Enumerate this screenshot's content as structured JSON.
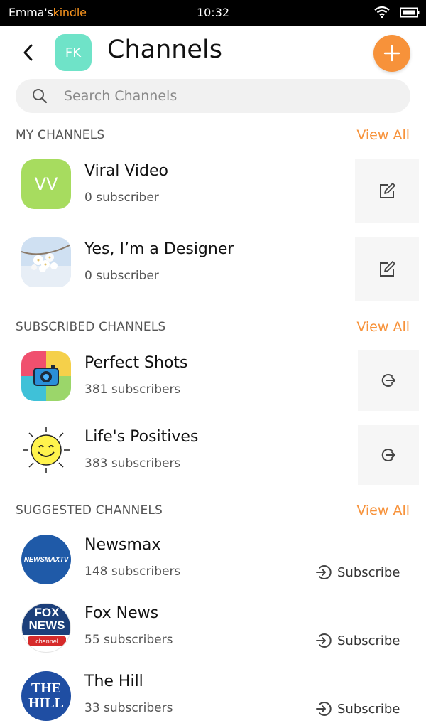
{
  "status_bar": {
    "device_name_owner": "Emma's",
    "device_name_brand": "kindle",
    "time": "10:32"
  },
  "header": {
    "avatar_initials": "FK",
    "title": "Channels",
    "avatar_color": "#6fe3c8",
    "accent_color": "#f7923a"
  },
  "search": {
    "placeholder": "Search Channels"
  },
  "sections": {
    "my": {
      "title": "MY CHANNELS",
      "view_all": "View All"
    },
    "subscribed": {
      "title": "SUBSCRIBED CHANNELS",
      "view_all": "View All"
    },
    "suggested": {
      "title": "SUGGESTED CHANNELS",
      "view_all": "View All"
    }
  },
  "my_channels": [
    {
      "name": "Viral Video",
      "subscribers": "0 subscriber",
      "initials": "VV",
      "action_icon": "edit-icon"
    },
    {
      "name": "Yes, I’m a Designer",
      "subscribers": "0 subscriber",
      "action_icon": "edit-icon"
    }
  ],
  "subscribed_channels": [
    {
      "name": "Perfect Shots",
      "subscribers": "381 subscribers",
      "action_icon": "unsubscribe-icon"
    },
    {
      "name": "Life's Positives",
      "subscribers": "383 subscribers",
      "action_icon": "unsubscribe-icon"
    }
  ],
  "suggested_channels": [
    {
      "name": "Newsmax",
      "subscribers": "148 subscribers",
      "logo_text": "NEWSMAXTV",
      "action_label": "Subscribe"
    },
    {
      "name": "Fox News",
      "subscribers": "55 subscribers",
      "logo_text_1": "FOX",
      "logo_text_2": "NEWS",
      "logo_text_3": "channel",
      "action_label": "Subscribe"
    },
    {
      "name": "The Hill",
      "subscribers": "33 subscribers",
      "logo_text_1": "THE",
      "logo_text_2": "HILL",
      "action_label": "Subscribe"
    }
  ]
}
